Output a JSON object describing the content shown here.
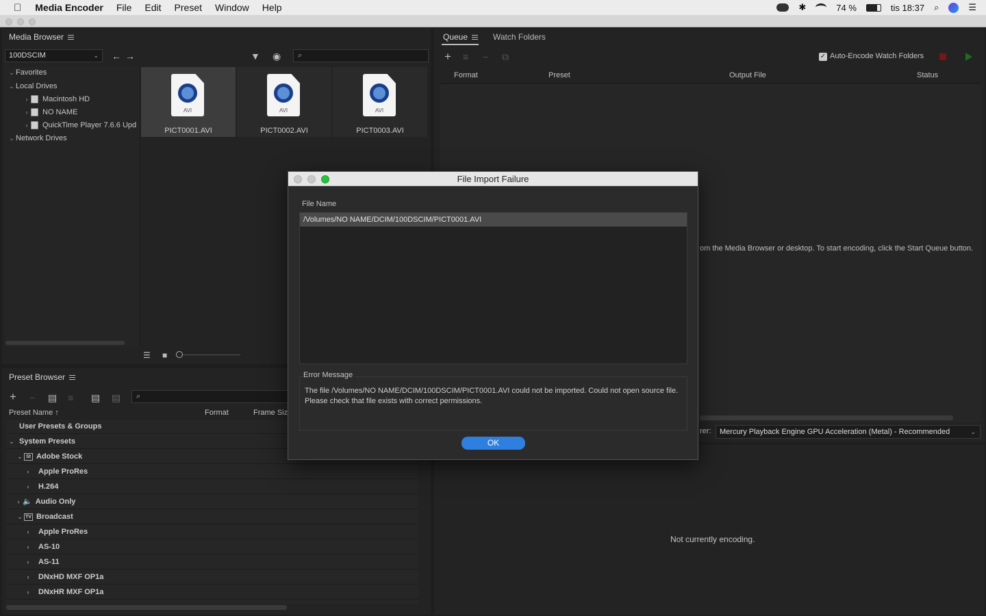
{
  "menubar": {
    "app_name": "Media Encoder",
    "items": [
      "File",
      "Edit",
      "Preset",
      "Window",
      "Help"
    ],
    "battery": "74 %",
    "clock": "tis 18:37"
  },
  "media_browser": {
    "title": "Media Browser",
    "folder_select": "100DSCIM",
    "tree": {
      "favorites": "Favorites",
      "local_drives": "Local Drives",
      "drives": [
        "Macintosh HD",
        "NO NAME",
        "QuickTime Player 7.6.6 Upd"
      ],
      "network_drives": "Network Drives"
    },
    "files": [
      "PICT0001.AVI",
      "PICT0002.AVI",
      "PICT0003.AVI"
    ],
    "file_badge": "AVI"
  },
  "queue": {
    "tab_queue": "Queue",
    "tab_watch": "Watch Folders",
    "auto_encode_label": "Auto-Encode Watch Folders",
    "columns": [
      "Format",
      "Preset",
      "Output File",
      "Status"
    ],
    "hint": "om the Media Browser or desktop.  To start encoding, click the Start Queue button.",
    "renderer_label": "rer:",
    "renderer_value": "Mercury Playback Engine GPU Acceleration (Metal) - Recommended"
  },
  "encoding": {
    "status": "Not currently encoding."
  },
  "preset_browser": {
    "title": "Preset Browser",
    "columns": [
      "Preset Name",
      "Format",
      "Frame Size"
    ],
    "rows": [
      {
        "label": "User Presets & Groups",
        "level": 0
      },
      {
        "label": "System Presets",
        "level": 0
      },
      {
        "label": "Adobe Stock",
        "level": 1,
        "icon": "St"
      },
      {
        "label": "Apple ProRes",
        "level": 2
      },
      {
        "label": "H.264",
        "level": 2
      },
      {
        "label": "Audio Only",
        "level": 1
      },
      {
        "label": "Broadcast",
        "level": 1,
        "icon": "TV"
      },
      {
        "label": "Apple ProRes",
        "level": 2
      },
      {
        "label": "AS-10",
        "level": 2
      },
      {
        "label": "AS-11",
        "level": 2
      },
      {
        "label": "DNxHD MXF OP1a",
        "level": 2
      },
      {
        "label": "DNxHR MXF OP1a",
        "level": 2
      }
    ]
  },
  "dialog": {
    "title": "File Import Failure",
    "file_name_label": "File Name",
    "file_path": "/Volumes/NO NAME/DCIM/100DSCIM/PICT0001.AVI",
    "error_label": "Error Message",
    "error_line1": "The file /Volumes/NO NAME/DCIM/100DSCIM/PICT0001.AVI could not be imported. Could not open source file.",
    "error_line2": "Please check that file exists with correct permissions.",
    "ok_label": "OK"
  },
  "colors": {
    "panel_bg": "#232323",
    "app_bg": "#1e1e1e",
    "accent_blue": "#2f7fe0",
    "stop_red": "#9b1b1b",
    "start_green": "#2e8a2e"
  }
}
